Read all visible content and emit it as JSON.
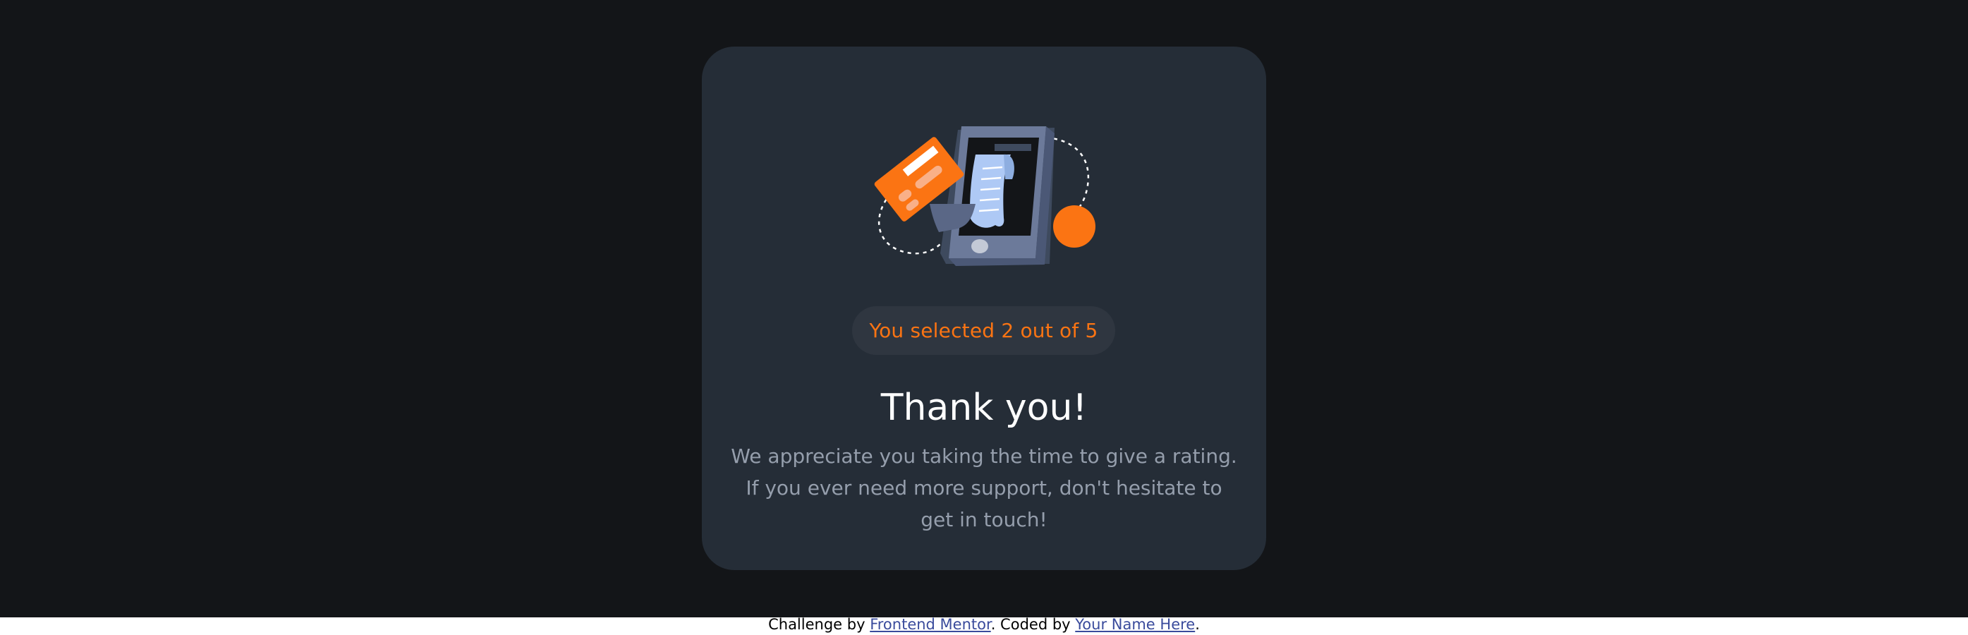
{
  "card": {
    "illustration": "phone-payment-receipt-illustration",
    "badge_text": "You selected 2 out of 5",
    "title": "Thank you!",
    "message": "We appreciate you taking the time to give a rating. If you ever need more support, don't hesitate to get in touch!",
    "colors": {
      "page_background": "#131518",
      "card_background": "#252d37",
      "accent": "#fb7413",
      "muted_text": "#959eac"
    }
  },
  "attribution": {
    "prefix": "Challenge by ",
    "challenge_link": "Frontend Mentor",
    "middle": ". Coded by ",
    "author_link": "Your Name Here",
    "suffix": "."
  }
}
